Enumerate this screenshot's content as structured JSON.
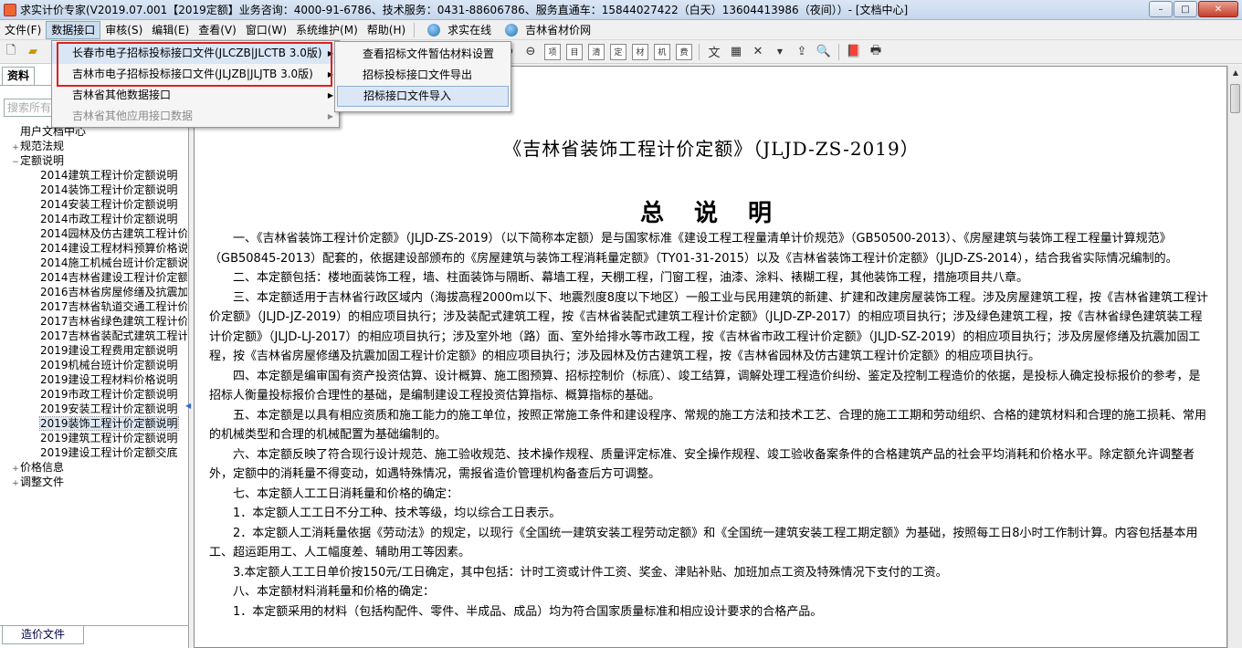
{
  "window": {
    "title": "求实计价专家(V2019.07.001【2019定额】业务咨询：4000-91-6786、技术服务：0431-88606786、服务直通车：15844027422（白天）13604413986（夜间））- [文档中心]",
    "buttons": {
      "minimize": "–",
      "maximize": "□",
      "close": "✕"
    }
  },
  "menubar": {
    "items": [
      "文件(F)",
      "数据接口",
      "审核(S)",
      "编辑(E)",
      "查看(V)",
      "窗口(W)",
      "系统维护(M)",
      "帮助(H)"
    ],
    "links": [
      "求实在线",
      "吉林省材价网"
    ]
  },
  "leftpanel": {
    "tab": "资料",
    "search_placeholder": "搜索所有",
    "tree": [
      {
        "level": 0,
        "exp": "",
        "label": "用户文档中心"
      },
      {
        "level": 0,
        "exp": "+",
        "label": "规范法规"
      },
      {
        "level": 0,
        "exp": "−",
        "label": "定额说明"
      },
      {
        "level": 1,
        "label": "2014建筑工程计价定额说明"
      },
      {
        "level": 1,
        "label": "2014装饰工程计价定额说明"
      },
      {
        "level": 1,
        "label": "2014安装工程计价定额说明"
      },
      {
        "level": 1,
        "label": "2014市政工程计价定额说明"
      },
      {
        "level": 1,
        "label": "2014园林及仿古建筑工程计价"
      },
      {
        "level": 1,
        "label": "2014建设工程材料预算价格说"
      },
      {
        "level": 1,
        "label": "2014施工机械台班计价定额说"
      },
      {
        "level": 1,
        "label": "2014吉林省建设工程计价定额"
      },
      {
        "level": 1,
        "label": "2016吉林省房屋修缮及抗震加"
      },
      {
        "level": 1,
        "label": "2017吉林省轨道交通工程计价"
      },
      {
        "level": 1,
        "label": "2017吉林省绿色建筑工程计价"
      },
      {
        "level": 1,
        "label": "2017吉林省装配式建筑工程计"
      },
      {
        "level": 1,
        "label": "2019建设工程费用定额说明"
      },
      {
        "level": 1,
        "label": "2019机械台班计价定额说明"
      },
      {
        "level": 1,
        "label": "2019建设工程材料价格说明"
      },
      {
        "level": 1,
        "label": "2019市政工程计价定额说明"
      },
      {
        "level": 1,
        "label": "2019安装工程计价定额说明"
      },
      {
        "level": 1,
        "label": "2019装饰工程计价定额说明",
        "selected": true
      },
      {
        "level": 1,
        "label": "2019建筑工程计价定额说明"
      },
      {
        "level": 1,
        "label": "2019建设工程计价定额交底"
      },
      {
        "level": 0,
        "exp": "+",
        "label": "价格信息"
      },
      {
        "level": 0,
        "exp": "+",
        "label": "调整文件"
      }
    ],
    "bottom_tab": "造价文件"
  },
  "menu_data_interface": {
    "items": [
      {
        "label": "长春市电子招标投标接口文件(JLCZB|JLCTB 3.0版)",
        "arrow": "▶"
      },
      {
        "label": "吉林市电子招标投标接口文件(JLJZB|JLJTB 3.0版)",
        "arrow": "▶"
      },
      {
        "label": "吉林省其他数据接口",
        "arrow": "▶"
      },
      {
        "label": "吉林省其他应用接口数据",
        "arrow": "▶"
      }
    ]
  },
  "submenu": {
    "items": [
      "查看招标文件暂估材料设置",
      "招标投标接口文件导出",
      "招标接口文件导入"
    ]
  },
  "document": {
    "title": "《吉林省装饰工程计价定额》（JLJD-ZS-2019）",
    "heading": "总 说 明",
    "paragraphs": [
      "一、《吉林省装饰工程计价定额》（JLJD-ZS-2019）（以下简称本定额）是与国家标准《建设工程工程量清单计价规范》（GB50500-2013）、《房屋建筑与装饰工程工程量计算规范》（GB50845-2013）配套的，依据建设部颁布的《房屋建筑与装饰工程消耗量定额》（TY01-31-2015）以及《吉林省装饰工程计价定额》（JLJD-ZS-2014），结合我省实际情况编制的。",
      "二、本定额包括：楼地面装饰工程，墙、柱面装饰与隔断、幕墙工程，天棚工程，门窗工程，油漆、涂料、裱糊工程，其他装饰工程，措施项目共八章。",
      "三、本定额适用于吉林省行政区域内（海拔高程2000m以下、地震烈度8度以下地区）一般工业与民用建筑的新建、扩建和改建房屋装饰工程。涉及房屋建筑工程，按《吉林省建筑工程计价定额》（JLJD-JZ-2019）的相应项目执行；涉及装配式建筑工程，按《吉林省装配式建筑工程计价定额》（JLJD-ZP-2017）的相应项目执行；涉及绿色建筑工程，按《吉林省绿色建筑装工程计价定额》（JLJD-LJ-2017）的相应项目执行；涉及室外地（路）面、室外给排水等市政工程，按《吉林省市政工程计价定额》（JLJD-SZ-2019）的相应项目执行；涉及房屋修缮及抗震加固工程，按《吉林省房屋修缮及抗震加固工程计价定额》的相应项目执行；涉及园林及仿古建筑工程，按《吉林省园林及仿古建筑工程计价定额》的相应项目执行。",
      "四、本定额是编审国有资产投资估算、设计概算、施工图预算、招标控制价（标底）、竣工结算，调解处理工程造价纠纷、鉴定及控制工程造价的依据，是投标人确定投标报价的参考，是招标人衡量投标报价合理性的基础，是编制建设工程投资估算指标、概算指标的基础。",
      "五、本定额是以具有相应资质和施工能力的施工单位，按照正常施工条件和建设程序、常规的施工方法和技术工艺、合理的施工工期和劳动组织、合格的建筑材料和合理的施工损耗、常用的机械类型和合理的机械配置为基础编制的。",
      "六、本定额反映了符合现行设计规范、施工验收规范、技术操作规程、质量评定标准、安全操作规程、竣工验收备案条件的合格建筑产品的社会平均消耗和价格水平。除定额允许调整者外，定额中的消耗量不得变动，如遇特殊情况，需报省造价管理机构备查后方可调整。",
      "七、本定额人工工日消耗量和价格的确定：",
      "1．本定额人工工日不分工种、技术等级，均以综合工日表示。",
      "2．本定额人工消耗量依据《劳动法》的规定，以现行《全国统一建筑安装工程劳动定额》和《全国统一建筑安装工程工期定额》为基础，按照每工日8小时工作制计算。内容包括基本用工、超运距用工、人工幅度差、辅助用工等因素。",
      "3.本定额人工工日单价按150元/工日确定，其中包括：计时工资或计件工资、奖金、津贴补贴、加班加点工资及特殊情况下支付的工资。",
      "八、本定额材料消耗量和价格的确定：",
      "1．本定额采用的材料（包括构配件、零件、半成品、成品）均为符合国家质量标准和相应设计要求的合格产品。"
    ]
  },
  "colors": {
    "highlight_outline": "#e0201c",
    "menu_hover": "#d9e6f6",
    "title_bar": "#c5d6ec"
  }
}
